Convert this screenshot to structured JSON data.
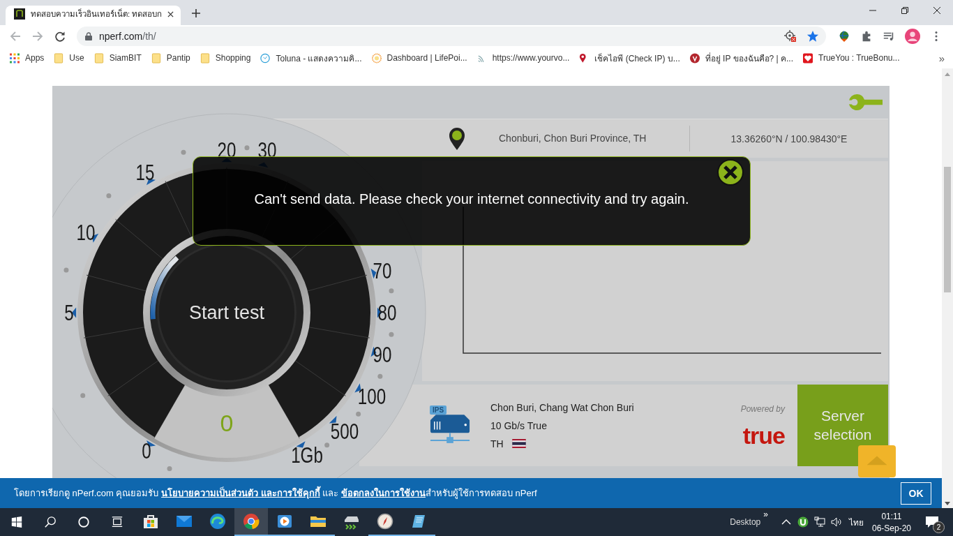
{
  "browser": {
    "tab": {
      "title": "ทดสอบความเร็วอินเทอร์เน็ต: ทดสอบก"
    },
    "address": {
      "host": "nperf.com",
      "path": "/th/"
    },
    "bookmarks": [
      {
        "kind": "apps",
        "label": "Apps"
      },
      {
        "kind": "folder",
        "label": "Use"
      },
      {
        "kind": "folder",
        "label": "SiamBIT"
      },
      {
        "kind": "folder",
        "label": "Pantip"
      },
      {
        "kind": "folder",
        "label": "Shopping"
      },
      {
        "kind": "chat",
        "label": "Toluna - แสดงความคิ..."
      },
      {
        "kind": "sun",
        "label": "Dashboard | LifePoi..."
      },
      {
        "kind": "waves",
        "label": "https://www.yourvo..."
      },
      {
        "kind": "pin",
        "label": "เช็คไอพี (Check IP) บ..."
      },
      {
        "kind": "vpn",
        "label": "ที่อยู่ IP ของฉันคือ? | ค..."
      },
      {
        "kind": "heart",
        "label": "TrueYou : TrueBonu..."
      }
    ],
    "bookmarks_more": "»"
  },
  "speedtest": {
    "location": {
      "city": "Chonburi, Chon Buri Province, TH",
      "coordinates": "13.36260°N / 100.98430°E"
    },
    "gauge": {
      "scale": [
        "0",
        "5",
        "10",
        "15",
        "20",
        "30",
        "70",
        "80",
        "90",
        "100",
        "500",
        "1Gb"
      ],
      "reading": "0",
      "button": "Start test"
    },
    "error": {
      "message": "Can't send data. Please check your internet connectivity and try again."
    },
    "server": {
      "icon_label": "IPS",
      "name": "Chon Buri, Chang Wat Chon Buri",
      "bandwidth": "10 Gb/s True",
      "country": "TH",
      "powered_by": "Powered by",
      "provider": "true",
      "button": "Server selection"
    }
  },
  "consent_banner": {
    "parts": [
      {
        "kind": "text",
        "text": "โดยการเรียกดู nPerf.com คุณยอมรับ "
      },
      {
        "kind": "link",
        "text": "นโยบายความเป็นส่วนตัว และการใช้คุกกี้"
      },
      {
        "kind": "text",
        "text": " และ "
      },
      {
        "kind": "link",
        "text": "ข้อตกลงในการใช้งาน"
      },
      {
        "kind": "text",
        "text": "สำหรับผู้ใช้การทดสอบ nPerf"
      }
    ],
    "ok": "OK"
  },
  "taskbar": {
    "apps": [
      {
        "kind": "store",
        "running": false,
        "selected": false
      },
      {
        "kind": "mail",
        "running": false,
        "selected": false
      },
      {
        "kind": "edge",
        "running": false,
        "selected": false
      },
      {
        "kind": "chrome",
        "running": true,
        "selected": true
      },
      {
        "kind": "media",
        "running": true,
        "selected": false
      },
      {
        "kind": "explorer",
        "running": true,
        "selected": false
      },
      {
        "kind": "drive",
        "running": false,
        "selected": false
      },
      {
        "kind": "compass",
        "running": true,
        "selected": false
      },
      {
        "kind": "notepad",
        "running": true,
        "selected": false
      }
    ],
    "tray": {
      "desktop": "Desktop",
      "more": "»",
      "language": "ไทย",
      "time": "01:11",
      "date": "06-Sep-20",
      "notifications": "2"
    }
  }
}
